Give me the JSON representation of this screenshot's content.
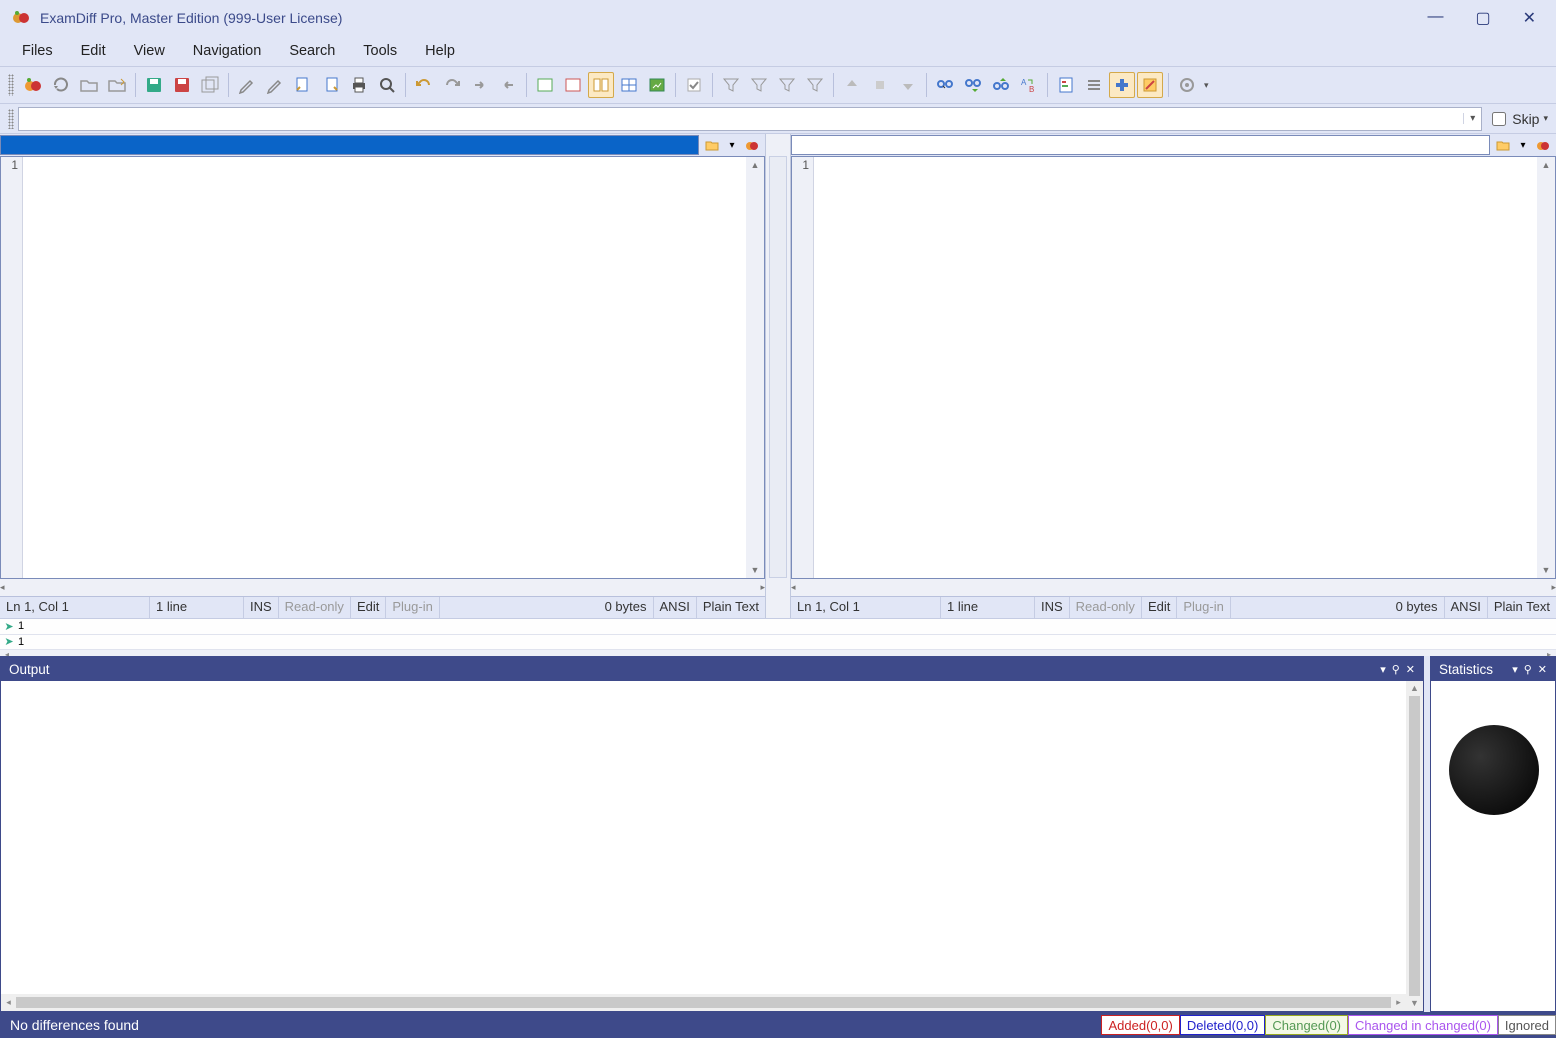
{
  "window": {
    "title": "ExamDiff Pro, Master Edition (999-User License)"
  },
  "menu": [
    "Files",
    "Edit",
    "View",
    "Navigation",
    "Search",
    "Tools",
    "Help"
  ],
  "skip": {
    "label": "Skip"
  },
  "left": {
    "lineno": "1",
    "status": {
      "pos": "Ln 1, Col 1",
      "lines": "1 line",
      "ins": "INS",
      "ro": "Read-only",
      "mode": "Edit",
      "plugin": "Plug-in",
      "size": "0 bytes",
      "enc": "ANSI",
      "ft": "Plain Text"
    }
  },
  "right": {
    "lineno": "1",
    "status": {
      "pos": "Ln 1, Col 1",
      "lines": "1 line",
      "ins": "INS",
      "ro": "Read-only",
      "mode": "Edit",
      "plugin": "Plug-in",
      "size": "0 bytes",
      "enc": "ANSI",
      "ft": "Plain Text"
    }
  },
  "minimap": {
    "r1": "1",
    "r2": "1"
  },
  "panels": {
    "output_title": "Output",
    "stats_title": "Statistics"
  },
  "statusbar": {
    "msg": "No differences found",
    "added": "Added(0,0)",
    "deleted": "Deleted(0,0)",
    "changed": "Changed(0)",
    "chinch": "Changed in changed(0)",
    "ignored": "Ignored"
  }
}
